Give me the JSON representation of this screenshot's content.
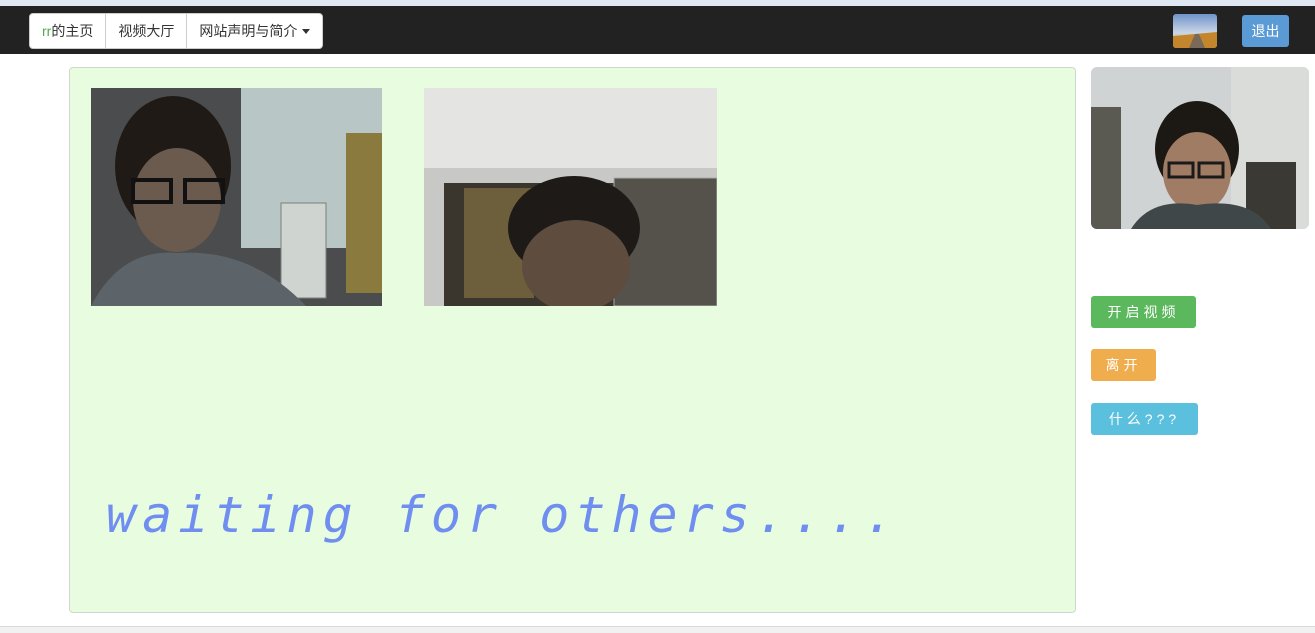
{
  "nav": {
    "home_prefix": "rr",
    "home_suffix": "的主页",
    "video_hall": "视频大厅",
    "about": "网站声明与简介",
    "logout": "退出"
  },
  "room": {
    "waiting_text": "waiting for others...."
  },
  "actions": {
    "start_video": "开启视频",
    "leave": "离开",
    "what": "什么???"
  },
  "colors": {
    "navbar": "#222222",
    "panel_bg": "#e8fde0",
    "start_btn": "#5cb85c",
    "leave_btn": "#f0ad4e",
    "what_btn": "#5bc0de",
    "logout_btn": "#5b9bd5"
  }
}
